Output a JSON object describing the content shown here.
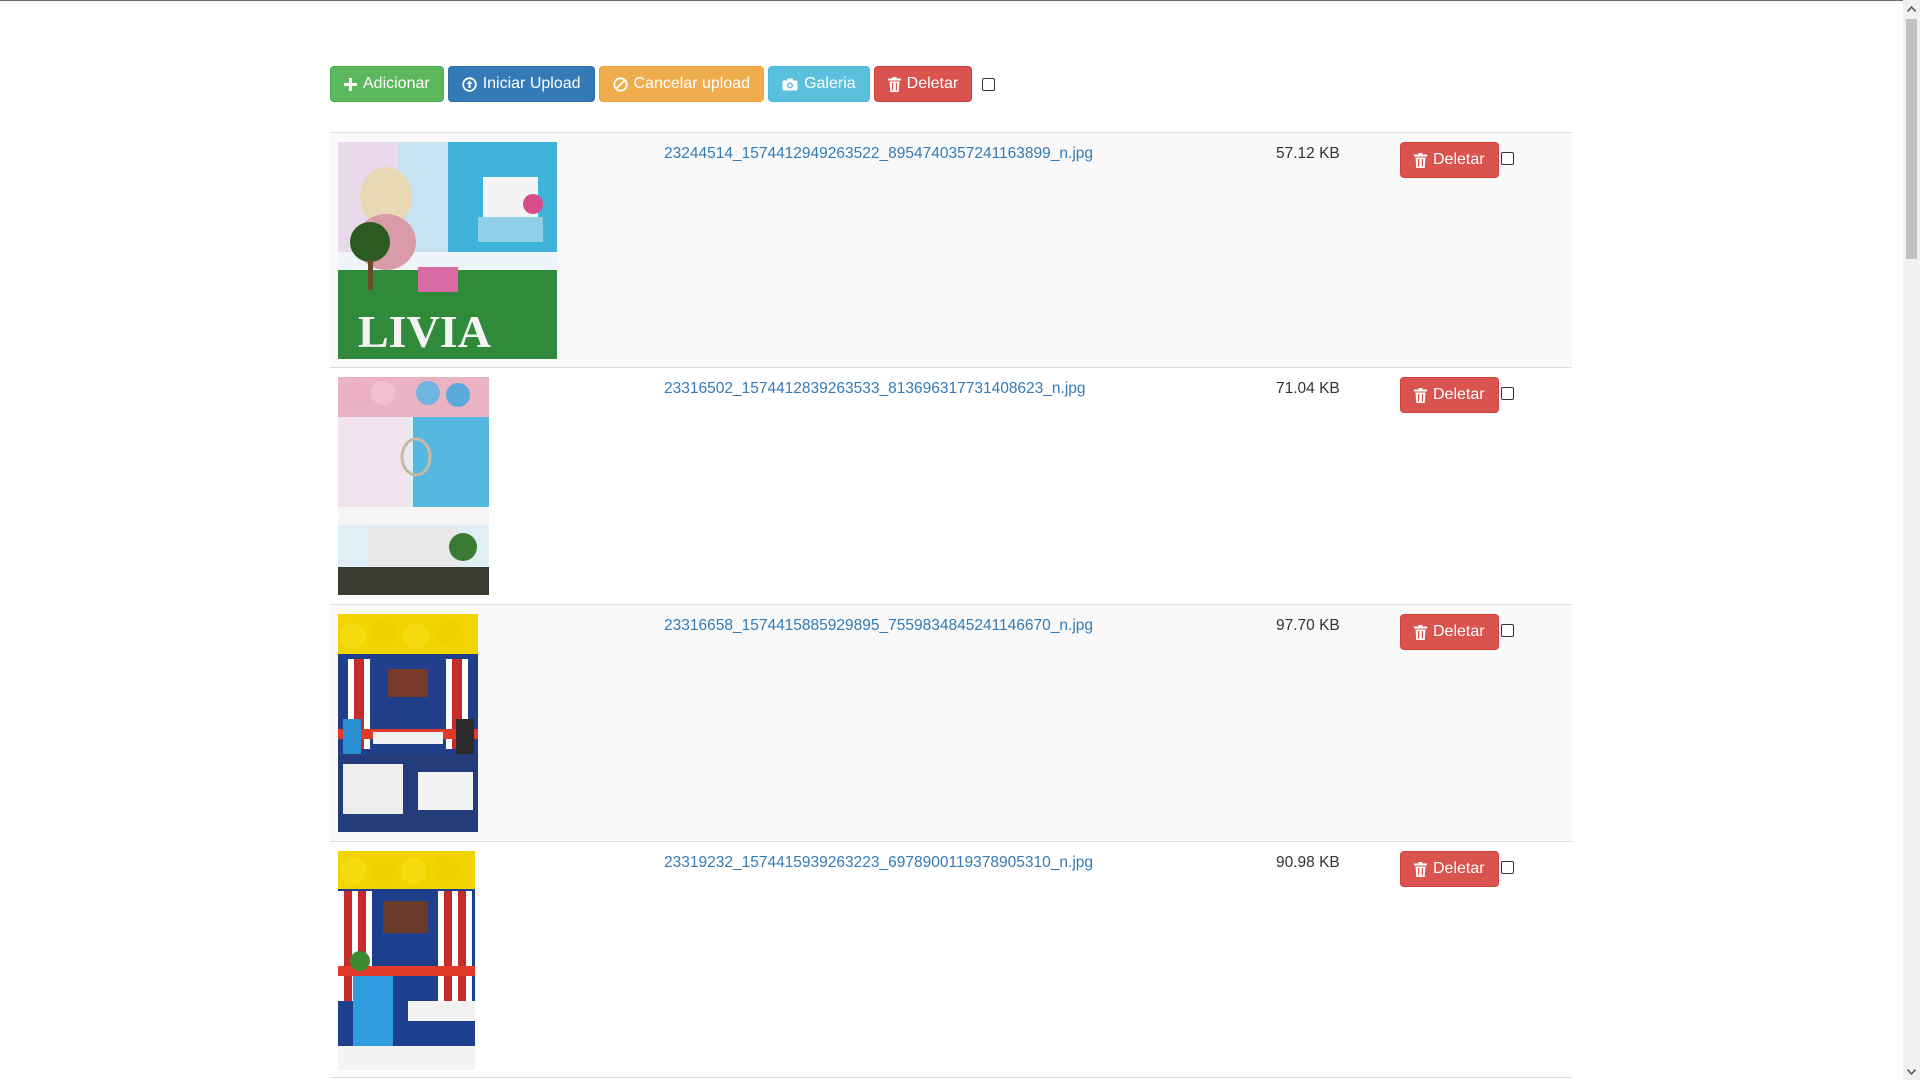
{
  "toolbar": {
    "add_label": "Adicionar",
    "start_upload_label": "Iniciar Upload",
    "cancel_upload_label": "Cancelar upload",
    "gallery_label": "Galeria",
    "delete_label": "Deletar"
  },
  "files": [
    {
      "name": "23244514_1574412949263522_8954740357241163899_n.jpg",
      "size": "57.12 KB",
      "delete_label": "Deletar"
    },
    {
      "name": "23316502_1574412839263533_813696317731408623_n.jpg",
      "size": "71.04 KB",
      "delete_label": "Deletar"
    },
    {
      "name": "23316658_1574415885929895_7559834845241146670_n.jpg",
      "size": "97.70 KB",
      "delete_label": "Deletar"
    },
    {
      "name": "23319232_1574415939263223_6978900119378905310_n.jpg",
      "size": "90.98 KB",
      "delete_label": "Deletar"
    }
  ],
  "colors": {
    "success": "#5cb85c",
    "primary": "#337ab7",
    "warning": "#f0ad4e",
    "info": "#5bc0de",
    "danger": "#d9534f",
    "link": "#337ab7"
  },
  "icons": {
    "add": "plus-icon",
    "start_upload": "upload-circle-icon",
    "cancel_upload": "ban-icon",
    "gallery": "camera-icon",
    "delete": "trash-icon"
  }
}
